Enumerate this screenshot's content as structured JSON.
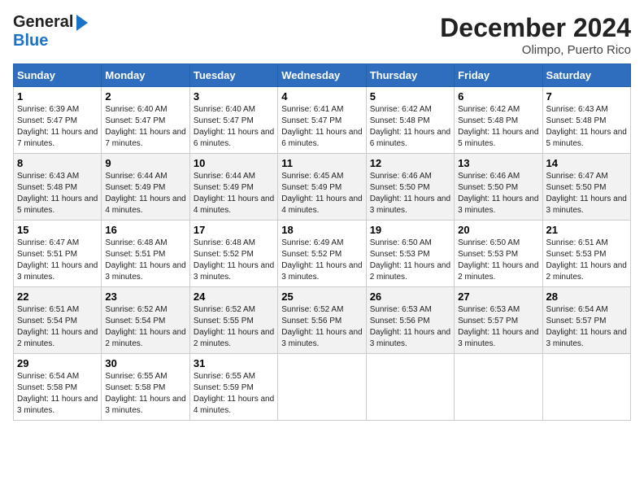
{
  "header": {
    "logo_line1": "General",
    "logo_line2": "Blue",
    "month_year": "December 2024",
    "location": "Olimpo, Puerto Rico"
  },
  "days_of_week": [
    "Sunday",
    "Monday",
    "Tuesday",
    "Wednesday",
    "Thursday",
    "Friday",
    "Saturday"
  ],
  "weeks": [
    [
      {
        "day": 1,
        "sunrise": "6:39 AM",
        "sunset": "5:47 PM",
        "daylight": "11 hours and 7 minutes."
      },
      {
        "day": 2,
        "sunrise": "6:40 AM",
        "sunset": "5:47 PM",
        "daylight": "11 hours and 7 minutes."
      },
      {
        "day": 3,
        "sunrise": "6:40 AM",
        "sunset": "5:47 PM",
        "daylight": "11 hours and 6 minutes."
      },
      {
        "day": 4,
        "sunrise": "6:41 AM",
        "sunset": "5:47 PM",
        "daylight": "11 hours and 6 minutes."
      },
      {
        "day": 5,
        "sunrise": "6:42 AM",
        "sunset": "5:48 PM",
        "daylight": "11 hours and 6 minutes."
      },
      {
        "day": 6,
        "sunrise": "6:42 AM",
        "sunset": "5:48 PM",
        "daylight": "11 hours and 5 minutes."
      },
      {
        "day": 7,
        "sunrise": "6:43 AM",
        "sunset": "5:48 PM",
        "daylight": "11 hours and 5 minutes."
      }
    ],
    [
      {
        "day": 8,
        "sunrise": "6:43 AM",
        "sunset": "5:48 PM",
        "daylight": "11 hours and 5 minutes."
      },
      {
        "day": 9,
        "sunrise": "6:44 AM",
        "sunset": "5:49 PM",
        "daylight": "11 hours and 4 minutes."
      },
      {
        "day": 10,
        "sunrise": "6:44 AM",
        "sunset": "5:49 PM",
        "daylight": "11 hours and 4 minutes."
      },
      {
        "day": 11,
        "sunrise": "6:45 AM",
        "sunset": "5:49 PM",
        "daylight": "11 hours and 4 minutes."
      },
      {
        "day": 12,
        "sunrise": "6:46 AM",
        "sunset": "5:50 PM",
        "daylight": "11 hours and 3 minutes."
      },
      {
        "day": 13,
        "sunrise": "6:46 AM",
        "sunset": "5:50 PM",
        "daylight": "11 hours and 3 minutes."
      },
      {
        "day": 14,
        "sunrise": "6:47 AM",
        "sunset": "5:50 PM",
        "daylight": "11 hours and 3 minutes."
      }
    ],
    [
      {
        "day": 15,
        "sunrise": "6:47 AM",
        "sunset": "5:51 PM",
        "daylight": "11 hours and 3 minutes."
      },
      {
        "day": 16,
        "sunrise": "6:48 AM",
        "sunset": "5:51 PM",
        "daylight": "11 hours and 3 minutes."
      },
      {
        "day": 17,
        "sunrise": "6:48 AM",
        "sunset": "5:52 PM",
        "daylight": "11 hours and 3 minutes."
      },
      {
        "day": 18,
        "sunrise": "6:49 AM",
        "sunset": "5:52 PM",
        "daylight": "11 hours and 3 minutes."
      },
      {
        "day": 19,
        "sunrise": "6:50 AM",
        "sunset": "5:53 PM",
        "daylight": "11 hours and 2 minutes."
      },
      {
        "day": 20,
        "sunrise": "6:50 AM",
        "sunset": "5:53 PM",
        "daylight": "11 hours and 2 minutes."
      },
      {
        "day": 21,
        "sunrise": "6:51 AM",
        "sunset": "5:53 PM",
        "daylight": "11 hours and 2 minutes."
      }
    ],
    [
      {
        "day": 22,
        "sunrise": "6:51 AM",
        "sunset": "5:54 PM",
        "daylight": "11 hours and 2 minutes."
      },
      {
        "day": 23,
        "sunrise": "6:52 AM",
        "sunset": "5:54 PM",
        "daylight": "11 hours and 2 minutes."
      },
      {
        "day": 24,
        "sunrise": "6:52 AM",
        "sunset": "5:55 PM",
        "daylight": "11 hours and 2 minutes."
      },
      {
        "day": 25,
        "sunrise": "6:52 AM",
        "sunset": "5:56 PM",
        "daylight": "11 hours and 3 minutes."
      },
      {
        "day": 26,
        "sunrise": "6:53 AM",
        "sunset": "5:56 PM",
        "daylight": "11 hours and 3 minutes."
      },
      {
        "day": 27,
        "sunrise": "6:53 AM",
        "sunset": "5:57 PM",
        "daylight": "11 hours and 3 minutes."
      },
      {
        "day": 28,
        "sunrise": "6:54 AM",
        "sunset": "5:57 PM",
        "daylight": "11 hours and 3 minutes."
      }
    ],
    [
      {
        "day": 29,
        "sunrise": "6:54 AM",
        "sunset": "5:58 PM",
        "daylight": "11 hours and 3 minutes."
      },
      {
        "day": 30,
        "sunrise": "6:55 AM",
        "sunset": "5:58 PM",
        "daylight": "11 hours and 3 minutes."
      },
      {
        "day": 31,
        "sunrise": "6:55 AM",
        "sunset": "5:59 PM",
        "daylight": "11 hours and 4 minutes."
      },
      null,
      null,
      null,
      null
    ]
  ]
}
